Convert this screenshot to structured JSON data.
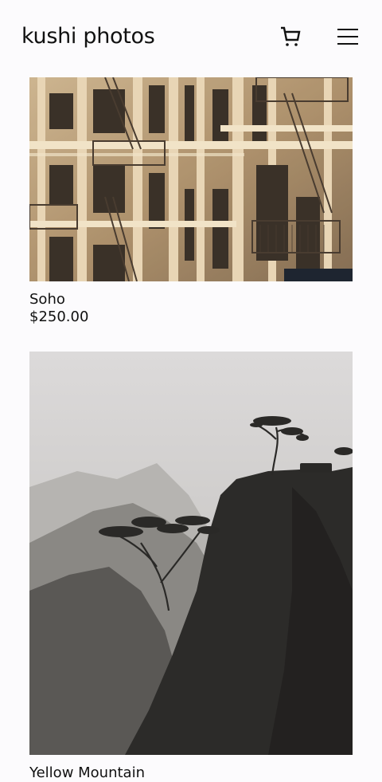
{
  "header": {
    "brand": "kushi photos",
    "cart_icon": "cart-icon",
    "menu_icon": "hamburger-menu-icon"
  },
  "products": [
    {
      "name": "Soho",
      "price": "$250.00",
      "image": "photo of ornate building facade with fire escapes"
    },
    {
      "name": "Yellow Mountain",
      "price": "",
      "image": "misty mountain cliffs with pine trees"
    }
  ],
  "colors": {
    "background": "#fcfbfd",
    "text": "#111111"
  }
}
